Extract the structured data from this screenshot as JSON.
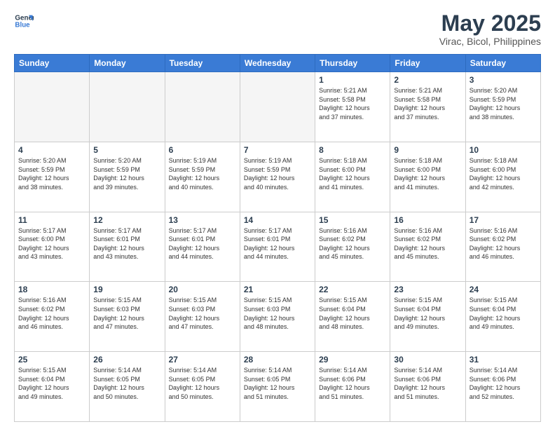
{
  "header": {
    "logo_line1": "General",
    "logo_line2": "Blue",
    "title": "May 2025",
    "subtitle": "Virac, Bicol, Philippines"
  },
  "weekdays": [
    "Sunday",
    "Monday",
    "Tuesday",
    "Wednesday",
    "Thursday",
    "Friday",
    "Saturday"
  ],
  "weeks": [
    [
      {
        "day": "",
        "info": ""
      },
      {
        "day": "",
        "info": ""
      },
      {
        "day": "",
        "info": ""
      },
      {
        "day": "",
        "info": ""
      },
      {
        "day": "1",
        "info": "Sunrise: 5:21 AM\nSunset: 5:58 PM\nDaylight: 12 hours\nand 37 minutes."
      },
      {
        "day": "2",
        "info": "Sunrise: 5:21 AM\nSunset: 5:58 PM\nDaylight: 12 hours\nand 37 minutes."
      },
      {
        "day": "3",
        "info": "Sunrise: 5:20 AM\nSunset: 5:59 PM\nDaylight: 12 hours\nand 38 minutes."
      }
    ],
    [
      {
        "day": "4",
        "info": "Sunrise: 5:20 AM\nSunset: 5:59 PM\nDaylight: 12 hours\nand 38 minutes."
      },
      {
        "day": "5",
        "info": "Sunrise: 5:20 AM\nSunset: 5:59 PM\nDaylight: 12 hours\nand 39 minutes."
      },
      {
        "day": "6",
        "info": "Sunrise: 5:19 AM\nSunset: 5:59 PM\nDaylight: 12 hours\nand 40 minutes."
      },
      {
        "day": "7",
        "info": "Sunrise: 5:19 AM\nSunset: 5:59 PM\nDaylight: 12 hours\nand 40 minutes."
      },
      {
        "day": "8",
        "info": "Sunrise: 5:18 AM\nSunset: 6:00 PM\nDaylight: 12 hours\nand 41 minutes."
      },
      {
        "day": "9",
        "info": "Sunrise: 5:18 AM\nSunset: 6:00 PM\nDaylight: 12 hours\nand 41 minutes."
      },
      {
        "day": "10",
        "info": "Sunrise: 5:18 AM\nSunset: 6:00 PM\nDaylight: 12 hours\nand 42 minutes."
      }
    ],
    [
      {
        "day": "11",
        "info": "Sunrise: 5:17 AM\nSunset: 6:00 PM\nDaylight: 12 hours\nand 43 minutes."
      },
      {
        "day": "12",
        "info": "Sunrise: 5:17 AM\nSunset: 6:01 PM\nDaylight: 12 hours\nand 43 minutes."
      },
      {
        "day": "13",
        "info": "Sunrise: 5:17 AM\nSunset: 6:01 PM\nDaylight: 12 hours\nand 44 minutes."
      },
      {
        "day": "14",
        "info": "Sunrise: 5:17 AM\nSunset: 6:01 PM\nDaylight: 12 hours\nand 44 minutes."
      },
      {
        "day": "15",
        "info": "Sunrise: 5:16 AM\nSunset: 6:02 PM\nDaylight: 12 hours\nand 45 minutes."
      },
      {
        "day": "16",
        "info": "Sunrise: 5:16 AM\nSunset: 6:02 PM\nDaylight: 12 hours\nand 45 minutes."
      },
      {
        "day": "17",
        "info": "Sunrise: 5:16 AM\nSunset: 6:02 PM\nDaylight: 12 hours\nand 46 minutes."
      }
    ],
    [
      {
        "day": "18",
        "info": "Sunrise: 5:16 AM\nSunset: 6:02 PM\nDaylight: 12 hours\nand 46 minutes."
      },
      {
        "day": "19",
        "info": "Sunrise: 5:15 AM\nSunset: 6:03 PM\nDaylight: 12 hours\nand 47 minutes."
      },
      {
        "day": "20",
        "info": "Sunrise: 5:15 AM\nSunset: 6:03 PM\nDaylight: 12 hours\nand 47 minutes."
      },
      {
        "day": "21",
        "info": "Sunrise: 5:15 AM\nSunset: 6:03 PM\nDaylight: 12 hours\nand 48 minutes."
      },
      {
        "day": "22",
        "info": "Sunrise: 5:15 AM\nSunset: 6:04 PM\nDaylight: 12 hours\nand 48 minutes."
      },
      {
        "day": "23",
        "info": "Sunrise: 5:15 AM\nSunset: 6:04 PM\nDaylight: 12 hours\nand 49 minutes."
      },
      {
        "day": "24",
        "info": "Sunrise: 5:15 AM\nSunset: 6:04 PM\nDaylight: 12 hours\nand 49 minutes."
      }
    ],
    [
      {
        "day": "25",
        "info": "Sunrise: 5:15 AM\nSunset: 6:04 PM\nDaylight: 12 hours\nand 49 minutes."
      },
      {
        "day": "26",
        "info": "Sunrise: 5:14 AM\nSunset: 6:05 PM\nDaylight: 12 hours\nand 50 minutes."
      },
      {
        "day": "27",
        "info": "Sunrise: 5:14 AM\nSunset: 6:05 PM\nDaylight: 12 hours\nand 50 minutes."
      },
      {
        "day": "28",
        "info": "Sunrise: 5:14 AM\nSunset: 6:05 PM\nDaylight: 12 hours\nand 51 minutes."
      },
      {
        "day": "29",
        "info": "Sunrise: 5:14 AM\nSunset: 6:06 PM\nDaylight: 12 hours\nand 51 minutes."
      },
      {
        "day": "30",
        "info": "Sunrise: 5:14 AM\nSunset: 6:06 PM\nDaylight: 12 hours\nand 51 minutes."
      },
      {
        "day": "31",
        "info": "Sunrise: 5:14 AM\nSunset: 6:06 PM\nDaylight: 12 hours\nand 52 minutes."
      }
    ]
  ]
}
